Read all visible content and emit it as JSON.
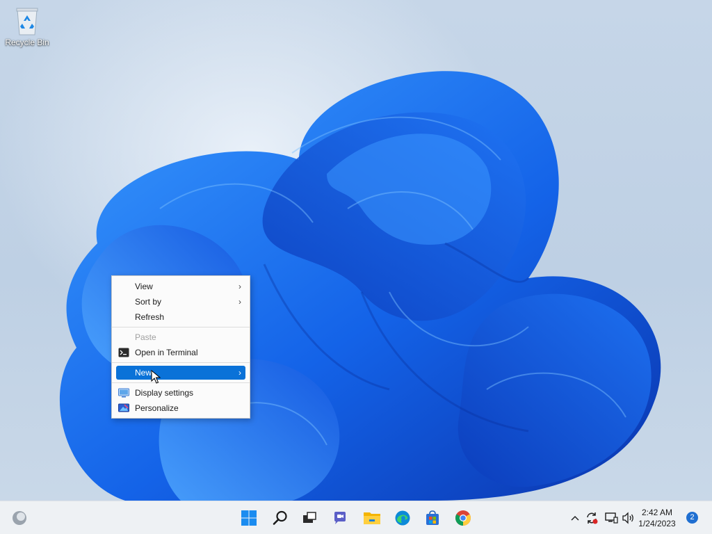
{
  "desktop": {
    "icons": [
      {
        "label": "Recycle Bin",
        "icon": "recycle-bin-icon"
      }
    ]
  },
  "context_menu": {
    "items": [
      {
        "label": "View",
        "has_submenu": true
      },
      {
        "label": "Sort by",
        "has_submenu": true
      },
      {
        "label": "Refresh"
      },
      {
        "label": "Paste",
        "disabled": true
      },
      {
        "label": "Open in Terminal",
        "icon": "terminal-icon"
      },
      {
        "label": "New",
        "has_submenu": true,
        "selected": true
      },
      {
        "label": "Display settings",
        "icon": "display-icon"
      },
      {
        "label": "Personalize",
        "icon": "personalize-icon"
      }
    ],
    "submenu_arrow": "›"
  },
  "taskbar": {
    "apps": [
      "widgets-icon",
      "start-icon",
      "search-icon",
      "task-view-icon",
      "chat-icon",
      "file-explorer-icon",
      "edge-icon",
      "store-icon",
      "chrome-icon"
    ],
    "tray": [
      "chevron-up-icon",
      "sync-icon",
      "network-icon",
      "volume-icon"
    ],
    "clock": {
      "time": "2:42 AM",
      "date": "1/24/2023"
    },
    "notification_count": "2"
  },
  "colors": {
    "accent": "#0a72d8",
    "bloom_dark": "#0b3fbf",
    "bloom_mid": "#1a6ef0",
    "bloom_light": "#3d9bff"
  }
}
